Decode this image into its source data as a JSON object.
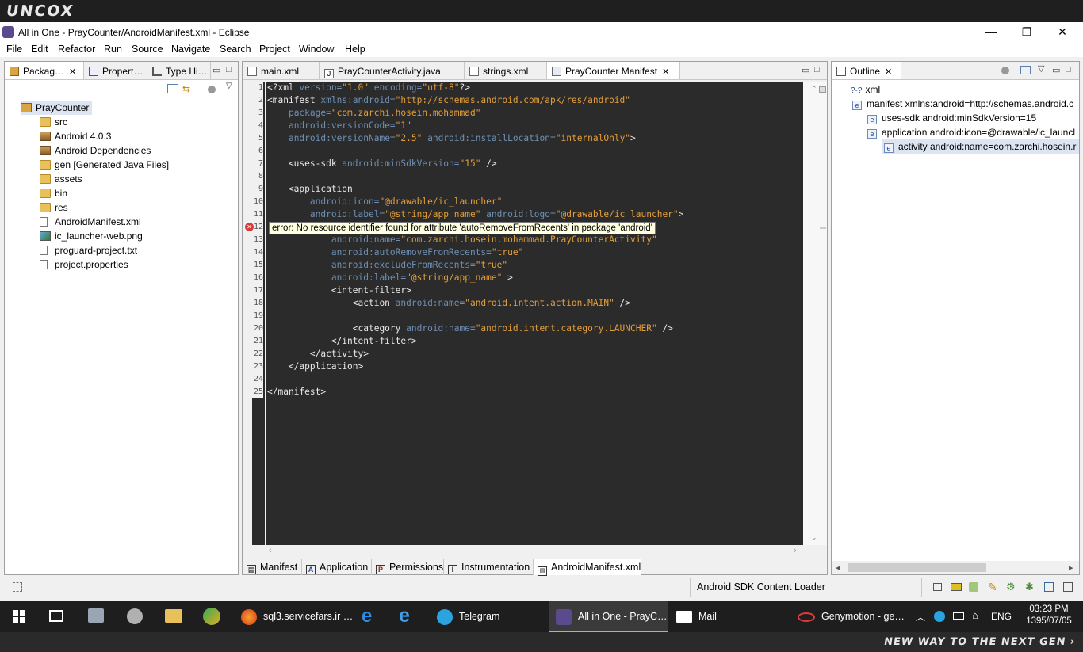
{
  "brand": {
    "logo_text": "UNCOX",
    "footer_text": "NEW WAY TO THE NEXT GEN ›"
  },
  "window": {
    "title": "All in One - PrayCounter/AndroidManifest.xml - Eclipse",
    "controls": {
      "minimize": "—",
      "maximize": "❐",
      "close": "✕"
    }
  },
  "menu": [
    "File",
    "Edit",
    "Refactor",
    "Run",
    "Source",
    "Navigate",
    "Search",
    "Project",
    "Window",
    "Help"
  ],
  "left_panel": {
    "tabs": [
      {
        "label": "Packag…"
      },
      {
        "label": "Propert…"
      },
      {
        "label": "Type Hi…"
      }
    ],
    "tree": {
      "root": "PrayCounter",
      "items": [
        {
          "label": "src",
          "icon": "package-folder-icon"
        },
        {
          "label": "Android 4.0.3",
          "icon": "library-icon"
        },
        {
          "label": "Android Dependencies",
          "icon": "library-icon"
        },
        {
          "label": "gen [Generated Java Files]",
          "icon": "package-folder-icon"
        },
        {
          "label": "assets",
          "icon": "folder-icon"
        },
        {
          "label": "bin",
          "icon": "folder-icon"
        },
        {
          "label": "res",
          "icon": "folder-icon"
        },
        {
          "label": "AndroidManifest.xml",
          "icon": "xml-file-icon"
        },
        {
          "label": "ic_launcher-web.png",
          "icon": "image-file-icon"
        },
        {
          "label": "proguard-project.txt",
          "icon": "text-file-icon"
        },
        {
          "label": "project.properties",
          "icon": "text-file-icon"
        }
      ]
    }
  },
  "editor": {
    "tabs": [
      {
        "label": "main.xml"
      },
      {
        "label": "PrayCounterActivity.java"
      },
      {
        "label": "strings.xml"
      },
      {
        "label": "PrayCounter Manifest"
      }
    ],
    "line_numbers": [
      "1",
      "2",
      "3",
      "4",
      "5",
      "6",
      "7",
      "8",
      "9",
      "10",
      "11",
      "12",
      "13",
      "14",
      "15",
      "16",
      "17",
      "18",
      "19",
      "20",
      "21",
      "22",
      "23",
      "24",
      "25"
    ],
    "error_tooltip": "error: No resource identifier found for attribute 'autoRemoveFromRecents' in package 'android'",
    "bottom_tabs": [
      {
        "label": "Manifest",
        "icon": "M"
      },
      {
        "label": "Application",
        "icon": "A"
      },
      {
        "label": "Permissions",
        "icon": "P"
      },
      {
        "label": "Instrumentation",
        "icon": "I"
      },
      {
        "label": "AndroidManifest.xml",
        "icon": "xml"
      }
    ]
  },
  "code_lines": [
    [
      [
        "decl",
        "<?xml "
      ],
      [
        "attr",
        "version="
      ],
      [
        "str",
        "\"1.0\""
      ],
      [
        "attr",
        " encoding="
      ],
      [
        "str",
        "\"utf-8\""
      ],
      [
        "decl",
        "?>"
      ]
    ],
    [
      [
        "tag",
        "<manifest "
      ],
      [
        "attr",
        "xmlns:android="
      ],
      [
        "str",
        "\"http://schemas.android.com/apk/res/android\""
      ]
    ],
    [
      [
        "tag",
        "    "
      ],
      [
        "attr",
        "package="
      ],
      [
        "str",
        "\"com.zarchi.hosein.mohammad\""
      ]
    ],
    [
      [
        "tag",
        "    "
      ],
      [
        "attr",
        "android:versionCode="
      ],
      [
        "str",
        "\"1\""
      ]
    ],
    [
      [
        "tag",
        "    "
      ],
      [
        "attr",
        "android:versionName="
      ],
      [
        "str",
        "\"2.5\""
      ],
      [
        "attr",
        " android:installLocation="
      ],
      [
        "str",
        "\"internalOnly\""
      ],
      [
        "tag",
        ">"
      ]
    ],
    [],
    [
      [
        "tag",
        "    <uses-sdk "
      ],
      [
        "attr",
        "android:minSdkVersion="
      ],
      [
        "str",
        "\"15\""
      ],
      [
        "tag",
        " />"
      ]
    ],
    [],
    [
      [
        "tag",
        "    <application"
      ]
    ],
    [
      [
        "tag",
        "        "
      ],
      [
        "attr",
        "android:icon="
      ],
      [
        "str",
        "\"@drawable/ic_launcher\""
      ]
    ],
    [
      [
        "tag",
        "        "
      ],
      [
        "attr",
        "android:label="
      ],
      [
        "str",
        "\"@string/app_name\""
      ],
      [
        "attr",
        " android:logo="
      ],
      [
        "str",
        "\"@drawable/ic_launcher\""
      ],
      [
        "tag",
        ">"
      ]
    ],
    [],
    [
      [
        "tag",
        "            "
      ],
      [
        "attr",
        "android:name="
      ],
      [
        "str",
        "\"com.zarchi.hosein.mohammad.PrayCounterActivity\""
      ]
    ],
    [
      [
        "tag",
        "            "
      ],
      [
        "attr",
        "android:autoRemoveFromRecents="
      ],
      [
        "str",
        "\"true\""
      ]
    ],
    [
      [
        "tag",
        "            "
      ],
      [
        "attr",
        "android:excludeFromRecents="
      ],
      [
        "str",
        "\"true\""
      ]
    ],
    [
      [
        "tag",
        "            "
      ],
      [
        "attr",
        "android:label="
      ],
      [
        "str",
        "\"@string/app_name\""
      ],
      [
        "tag",
        " >"
      ]
    ],
    [
      [
        "tag",
        "            <intent-filter>"
      ]
    ],
    [
      [
        "tag",
        "                <action "
      ],
      [
        "attr",
        "android:name="
      ],
      [
        "str",
        "\"android.intent.action.MAIN\""
      ],
      [
        "tag",
        " />"
      ]
    ],
    [],
    [
      [
        "tag",
        "                <category "
      ],
      [
        "attr",
        "android:name="
      ],
      [
        "str",
        "\"android.intent.category.LAUNCHER\""
      ],
      [
        "tag",
        " />"
      ]
    ],
    [
      [
        "tag",
        "            </intent-filter>"
      ]
    ],
    [
      [
        "tag",
        "        </activity>"
      ]
    ],
    [
      [
        "tag",
        "    </application>"
      ]
    ],
    [],
    [
      [
        "tag",
        "</manifest>"
      ]
    ]
  ],
  "outline": {
    "title": "Outline",
    "items": [
      {
        "label": "xml",
        "icon": "?-?"
      },
      {
        "label": "manifest xmlns:android=http://schemas.android.c",
        "icon": "e"
      },
      {
        "label": "uses-sdk android:minSdkVersion=15",
        "icon": "e"
      },
      {
        "label": "application android:icon=@drawable/ic_launcl",
        "icon": "e"
      },
      {
        "label": "activity android:name=com.zarchi.hosein.r",
        "icon": "e"
      }
    ]
  },
  "statusbar": {
    "task": "Android SDK Content Loader"
  },
  "taskbar": {
    "items": [
      {
        "label": "sql3.servicefars.ir …"
      },
      {
        "label": "Telegram"
      },
      {
        "label": "All in One - PrayC…"
      },
      {
        "label": "Mail"
      },
      {
        "label": "Genymotion - ge…"
      }
    ],
    "language": "ENG",
    "time": "03:23 PM",
    "date": "1395/07/05"
  },
  "colors": {
    "editor_bg": "#2b2b2b",
    "attr": "#6e8fb3",
    "string": "#e39e3b",
    "error": "#d83a3a",
    "taskbar_bg": "#1e1e1e"
  }
}
